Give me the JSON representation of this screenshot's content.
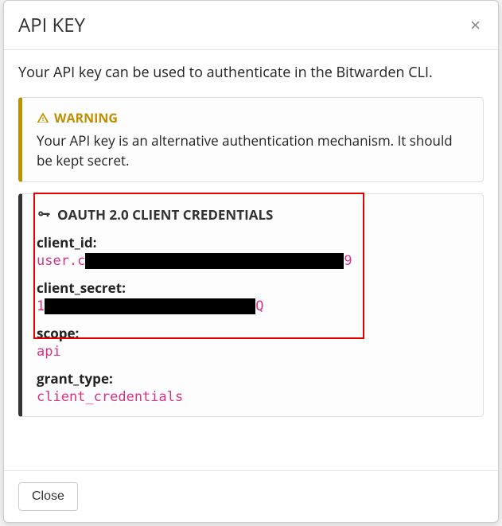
{
  "header": {
    "title": "API KEY"
  },
  "body": {
    "description": "Your API key can be used to authenticate in the Bitwarden CLI.",
    "warning": {
      "title": "WARNING",
      "text": "Your API key is an alternative authentication mechanism. It should be kept secret."
    },
    "credentials": {
      "title": "OAUTH 2.0 CLIENT CREDENTIALS",
      "client_id_label": "client_id:",
      "client_id_prefix": "user.c",
      "client_id_suffix": "9",
      "client_secret_label": "client_secret:",
      "client_secret_prefix": "1",
      "client_secret_suffix": "Q",
      "scope_label": "scope:",
      "scope_value": "api",
      "grant_type_label": "grant_type:",
      "grant_type_value": "client_credentials"
    }
  },
  "footer": {
    "close": "Close"
  }
}
